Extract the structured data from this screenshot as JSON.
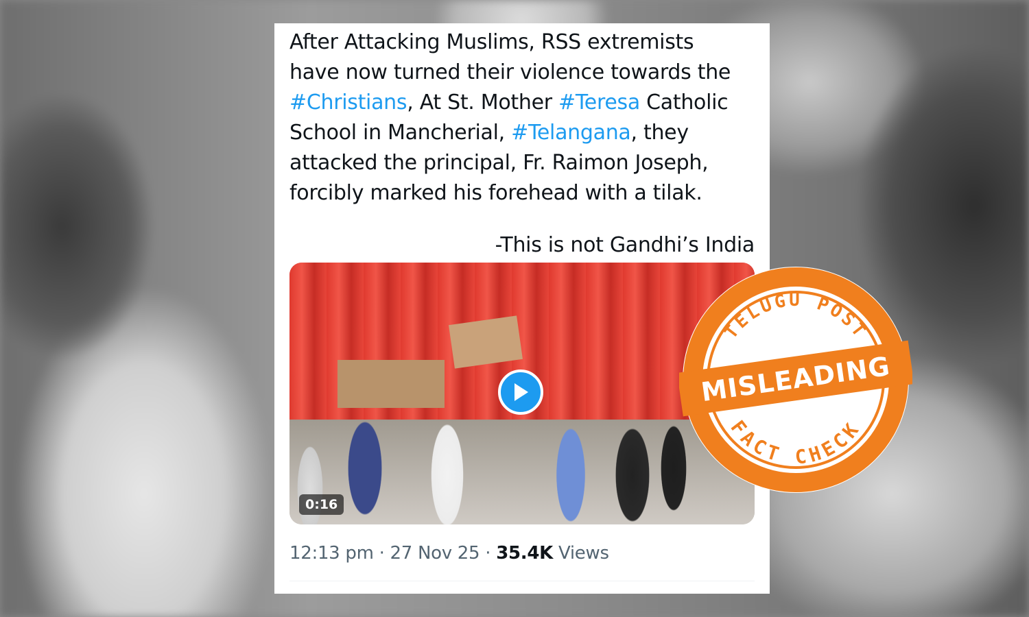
{
  "tweet": {
    "lines": [
      [
        {
          "t": "After Attacking Muslims, RSS extremists",
          "h": false
        }
      ],
      [
        {
          "t": "have now turned their violence towards the",
          "h": false
        }
      ],
      [
        {
          "t": "#Christians",
          "h": true
        },
        {
          "t": ", At St. Mother ",
          "h": false
        },
        {
          "t": "#Teresa",
          "h": true
        },
        {
          "t": " Catholic",
          "h": false
        }
      ],
      [
        {
          "t": "School in Mancherial, ",
          "h": false
        },
        {
          "t": "#Telangana",
          "h": true
        },
        {
          "t": ", they",
          "h": false
        }
      ],
      [
        {
          "t": "attacked the principal, Fr. Raimon Joseph,",
          "h": false
        }
      ],
      [
        {
          "t": "forcibly marked his forehead with a tilak.",
          "h": false
        }
      ]
    ],
    "signoff": "-This is not Gandhi’s India",
    "video": {
      "duration": "0:16"
    },
    "meta": {
      "time": "12:13 pm",
      "sep1": " · ",
      "date": "27 Nov 25",
      "sep2": " · ",
      "views_count": "35.4K",
      "views_label": " Views"
    }
  },
  "stamp": {
    "top_text": "TELUGU POST",
    "verdict": "MISLEADING",
    "bottom_text": "FACT CHECK",
    "color": "#f07f1e"
  },
  "colors": {
    "hashtag": "#1d9bf0",
    "text": "#0f1419",
    "meta": "#536471"
  }
}
